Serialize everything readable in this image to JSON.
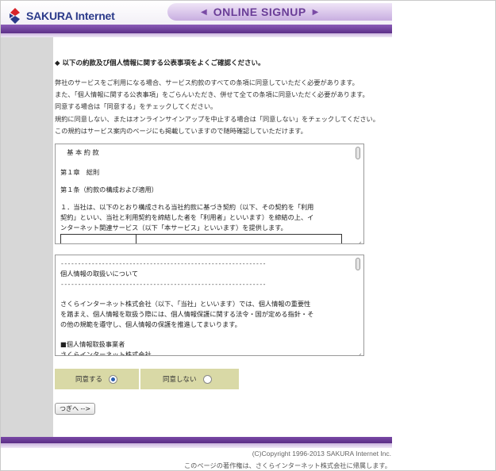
{
  "header": {
    "logo_text": "SAKURA Internet",
    "banner_title": "ONLINE SIGNUP",
    "colors": {
      "accent": "#6a3d97",
      "logo_blue": "#2b3a8a",
      "logo_red": "#d8232a"
    }
  },
  "main": {
    "heading": "◆ 以下の約款及び個人情報に関する公表事項をよくご確認ください。",
    "intro_lines": [
      "弊社のサービスをご利用になる場合、サービス約款のすべての条項に同意していただく必要があります。",
      "また、「個人情報に関する公表事項」をごらんいただき、併せて全ての条項に同意いただく必要があります。",
      "同意する場合は「同意する」をチェックしてください。",
      "規約に同意しない、またはオンラインサインアップを中止する場合は「同意しない」をチェックしてください。",
      "この規約はサービス案内のページにも掲載していますので随時確認していただけます。"
    ]
  },
  "terms": {
    "title": "　基 本 約 款",
    "chapter": "第１章　総則",
    "article": "第１条（約款の構成および適用）",
    "para_lines": [
      "１．当社は、以下のとおり構成される当社約款に基づき契約（以下、その契約を「利用",
      "契約」といい、当社と利用契約を締結した者を「利用者」といいます）を締結の上、イ",
      "ンターネット関連サービス（以下「本サービス」といいます）を提供します。"
    ]
  },
  "privacy": {
    "dashes_top": "------------------------------------------------------------",
    "title": "個人情報の取扱いについて",
    "dashes_bottom": "------------------------------------------------------------",
    "para_lines": [
      "さくらインターネット株式会社（以下、「当社」といいます）では、個人情報の重要性",
      "を踏まえ、個人情報を取扱う際には、個人情報保護に関する法令・国が定める指針・そ",
      "の他の規範を遵守し、個人情報の保護を推進してまいります。"
    ],
    "section_title": "■個人情報取扱事業者",
    "section_value": "さくらインターネット株式会社"
  },
  "consent": {
    "agree_label": "同意する",
    "disagree_label": "同意しない",
    "selected": "agree"
  },
  "next_button": "つぎへ -->",
  "footer": {
    "copyright": "(C)Copyright 1996-2013 SAKURA Internet Inc.",
    "notice": "このページの著作権は、さくらインターネット株式会社に帰属します。"
  }
}
